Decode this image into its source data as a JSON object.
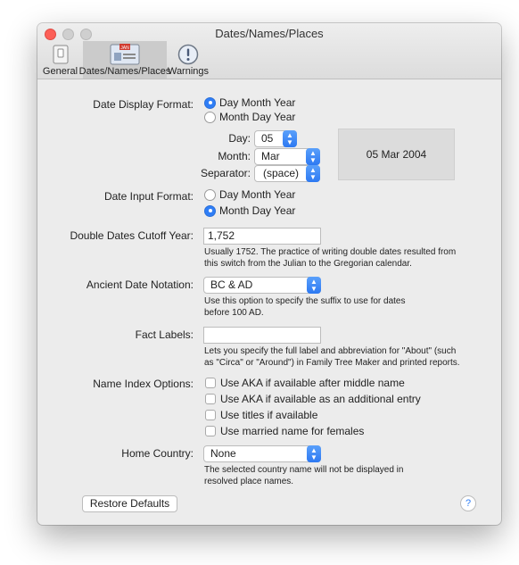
{
  "window": {
    "title": "Dates/Names/Places"
  },
  "toolbar": {
    "items": [
      {
        "label": "General",
        "icon": "switch-icon"
      },
      {
        "label": "Dates/Names/Places",
        "icon": "calendar-card-icon",
        "badge": "JAN"
      },
      {
        "label": "Warnings",
        "icon": "warning-icon"
      }
    ]
  },
  "date_display": {
    "label": "Date Display Format:",
    "options": [
      "Day Month Year",
      "Month Day Year"
    ],
    "selected": "Day Month Year",
    "day_label": "Day:",
    "day_value": "05",
    "month_label": "Month:",
    "month_value": "Mar",
    "separator_label": "Separator:",
    "separator_value": "(space)",
    "preview": "05 Mar 2004"
  },
  "date_input": {
    "label": "Date Input Format:",
    "options": [
      "Day Month Year",
      "Month Day Year"
    ],
    "selected": "Month Day Year"
  },
  "double_dates": {
    "label": "Double Dates Cutoff Year:",
    "value": "1,752",
    "help": "Usually 1752. The practice of writing double dates resulted from this switch from the Julian to the Gregorian calendar."
  },
  "ancient": {
    "label": "Ancient Date Notation:",
    "value": "BC & AD",
    "help": "Use this option to specify the suffix to use for dates before 100 AD."
  },
  "fact_labels": {
    "label": "Fact Labels:",
    "value": "",
    "help": "Lets you specify the full label and abbreviation for \"About\" (such as \"Circa\" or \"Around\") in Family Tree Maker and printed reports."
  },
  "name_index": {
    "label": "Name Index Options:",
    "options": [
      "Use AKA if available after middle name",
      "Use AKA if available as an additional entry",
      "Use titles if available",
      "Use married name for females"
    ]
  },
  "home_country": {
    "label": "Home Country:",
    "value": "None",
    "help": "The selected country name will not be displayed in resolved place names."
  },
  "footer": {
    "restore_label": "Restore Defaults",
    "help_glyph": "?"
  },
  "colors": {
    "accent": "#2f7ef6",
    "close": "#fc5f57"
  }
}
